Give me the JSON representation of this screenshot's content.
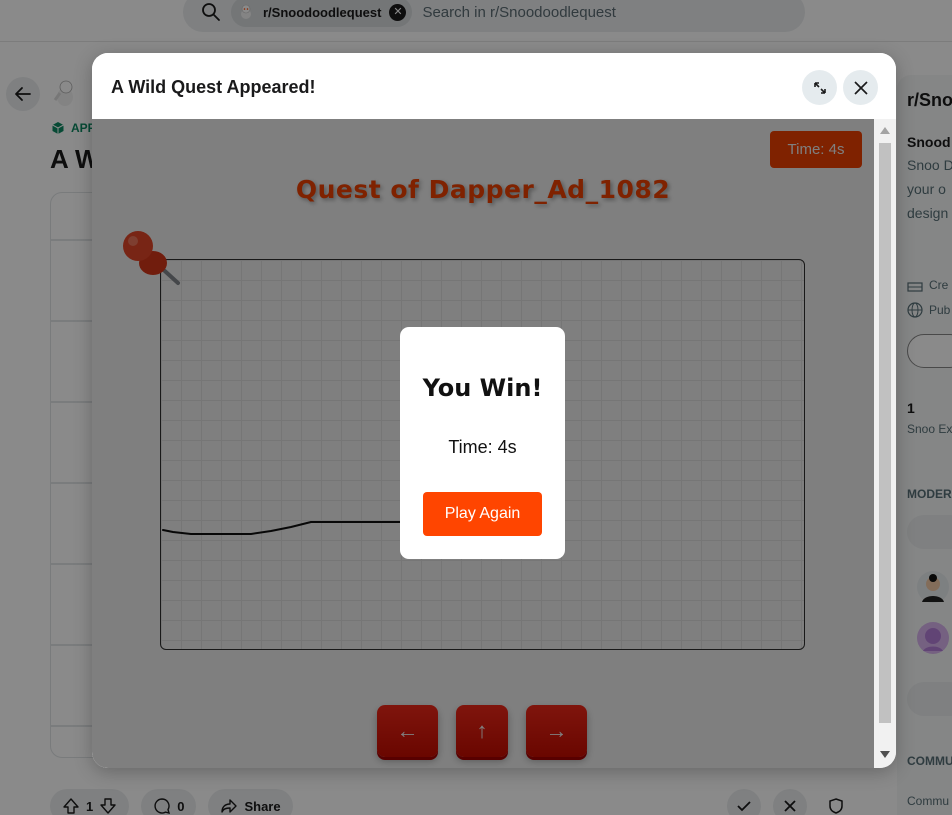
{
  "search": {
    "community_chip": "r/Snoodoodlequest",
    "placeholder": "Search in r/Snoodoodlequest"
  },
  "post": {
    "app_badge": "APP",
    "title": "A W",
    "upvotes": "1",
    "comments": "0",
    "share_label": "Share"
  },
  "sidebar": {
    "community_name": "r/Snoo",
    "about_title": "Snood",
    "desc_lines": [
      "Snoo D",
      "your o",
      "design"
    ],
    "meta_created": "Cre",
    "meta_public": "Pub",
    "member_count": "1",
    "member_label": "Snoo Ex",
    "moderators_header": "MODER",
    "community_header": "COMMU",
    "community_sub": "Commu"
  },
  "modal": {
    "title": "A Wild Quest Appeared!"
  },
  "game": {
    "timer": "Time: 4s",
    "quest_title": "Quest of Dapper_Ad_1082",
    "controls": {
      "left": "←",
      "up": "↑",
      "right": "→"
    },
    "accent_color": "#ff4500"
  },
  "win_dialog": {
    "title": "You Win!",
    "time_text": "Time: 4s",
    "play_again": "Play Again"
  }
}
